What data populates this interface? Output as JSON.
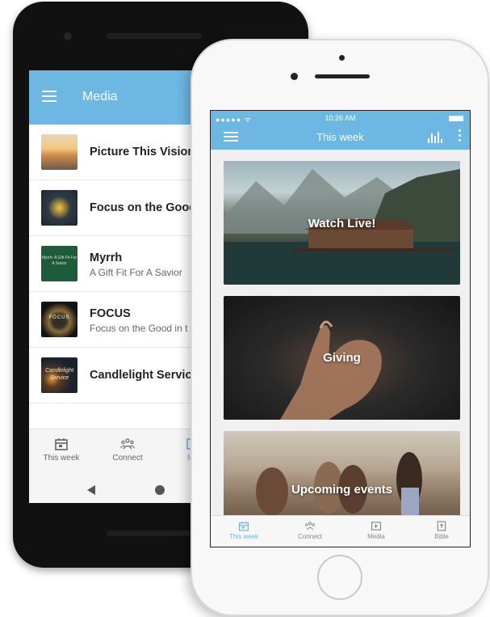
{
  "android": {
    "appbar_title": "Media",
    "items": [
      {
        "title": "Picture This Vision",
        "subtitle": ""
      },
      {
        "title": "Focus on the Good",
        "subtitle": ""
      },
      {
        "title": "Myrrh",
        "subtitle": "A Gift Fit For A Savior",
        "thumb_text": "Myrrh: A Gift Fit For A Savior"
      },
      {
        "title": "FOCUS",
        "subtitle": "Focus on the Good in t",
        "thumb_text": "FOCUS"
      },
      {
        "title": "Candlelight Service",
        "subtitle": "",
        "thumb_text": "Candlelight Service"
      }
    ],
    "tabs": [
      {
        "label": "This week",
        "icon": "calendar-icon"
      },
      {
        "label": "Connect",
        "icon": "people-icon"
      },
      {
        "label": "Me",
        "icon": "media-icon"
      }
    ]
  },
  "iphone": {
    "status": {
      "signal": "●●●●● ᯤ",
      "time": "10:26 AM"
    },
    "title": "This week",
    "cards": [
      {
        "label": "Watch Live!"
      },
      {
        "label": "Giving"
      },
      {
        "label": "Upcoming events"
      }
    ],
    "tabs": [
      {
        "label": "This week",
        "icon": "calendar-icon",
        "active": true
      },
      {
        "label": "Connect",
        "icon": "people-icon"
      },
      {
        "label": "Media",
        "icon": "media-icon"
      },
      {
        "label": "Bible",
        "icon": "bible-icon"
      }
    ]
  },
  "colors": {
    "accent": "#6cb8e3"
  }
}
